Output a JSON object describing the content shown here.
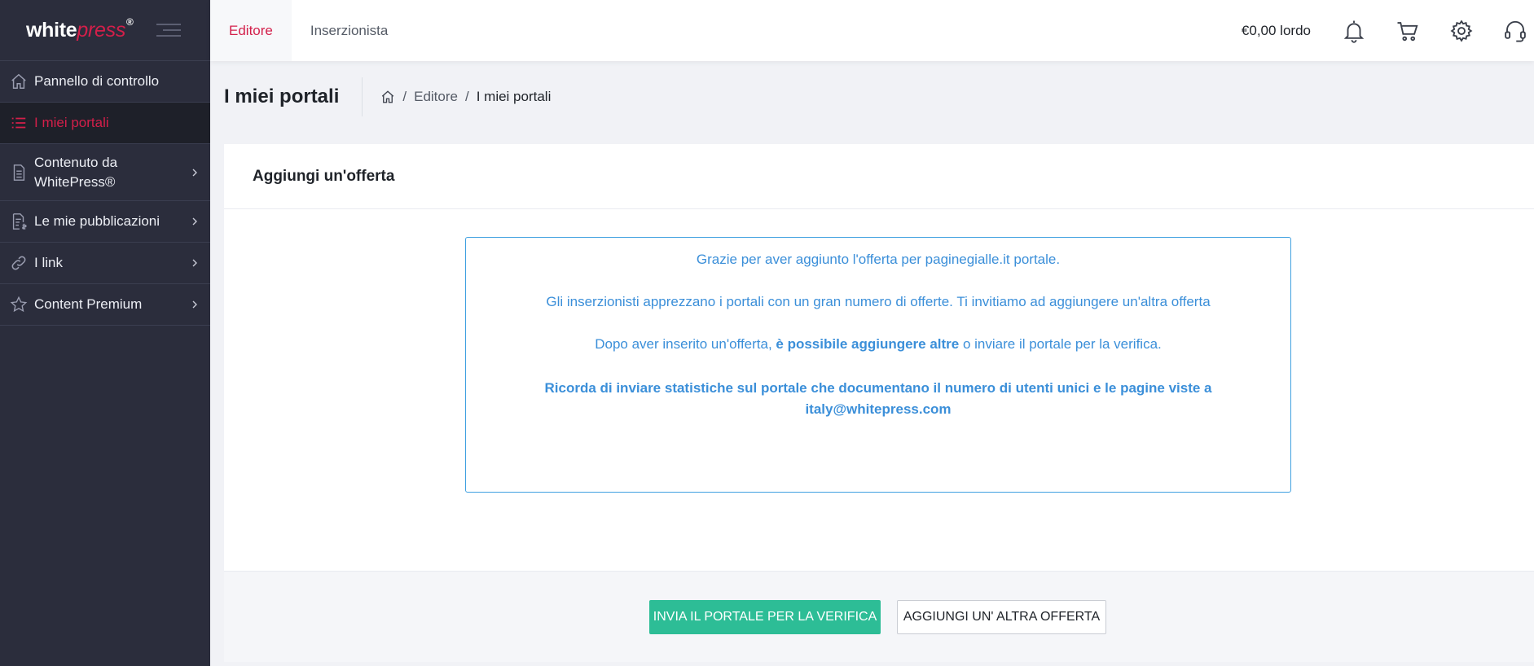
{
  "logo": {
    "white": "white",
    "press": "press",
    "mark": "®"
  },
  "sidebar": {
    "items": [
      {
        "label": "Pannello di controllo",
        "icon": "home-icon"
      },
      {
        "label": "I miei portali",
        "icon": "list-icon",
        "active": true
      },
      {
        "label_line1": "Contenuto da",
        "label_line2": "WhitePress®",
        "icon": "document-icon"
      },
      {
        "label": "Le mie pubblicazioni",
        "icon": "invoice-icon"
      },
      {
        "label": "I link",
        "icon": "link-icon"
      },
      {
        "label": "Content Premium",
        "icon": "star-icon"
      }
    ]
  },
  "topbar": {
    "tabs": [
      {
        "label": "Editore",
        "active": true
      },
      {
        "label": "Inserzionista"
      }
    ],
    "balance": "€0,00 lordo"
  },
  "page": {
    "title": "I miei portali",
    "breadcrumb": [
      "Editore",
      "I miei portali"
    ]
  },
  "card": {
    "title": "Aggiungi un'offerta",
    "message": {
      "line1": "Grazie per aver aggiunto l'offerta per paginegialle.it portale.",
      "line2": "Gli inserzionisti apprezzano i portali con un gran numero di offerte. Ti invitiamo ad aggiungere un'altra offerta",
      "line3_pre": "Dopo aver inserito un'offerta, ",
      "line3_bold": "è possibile aggiungere altre",
      "line3_post": " o inviare il portale per la verifica.",
      "line4_a": "Ricorda di inviare statistiche sul portale che documentano il numero di utenti unici e le pagine viste a",
      "line4_b": "italy@whitepress.com"
    },
    "buttons": {
      "submit": "INVIA IL PORTALE PER LA VERIFICA",
      "add": "AGGIUNGI UN' ALTRA OFFERTA"
    }
  },
  "colors": {
    "sidebar_bg": "#2b2d3c",
    "brand_red": "#d31f4a",
    "info_blue": "#3b8fd9",
    "primary_green": "#2dbd96"
  }
}
